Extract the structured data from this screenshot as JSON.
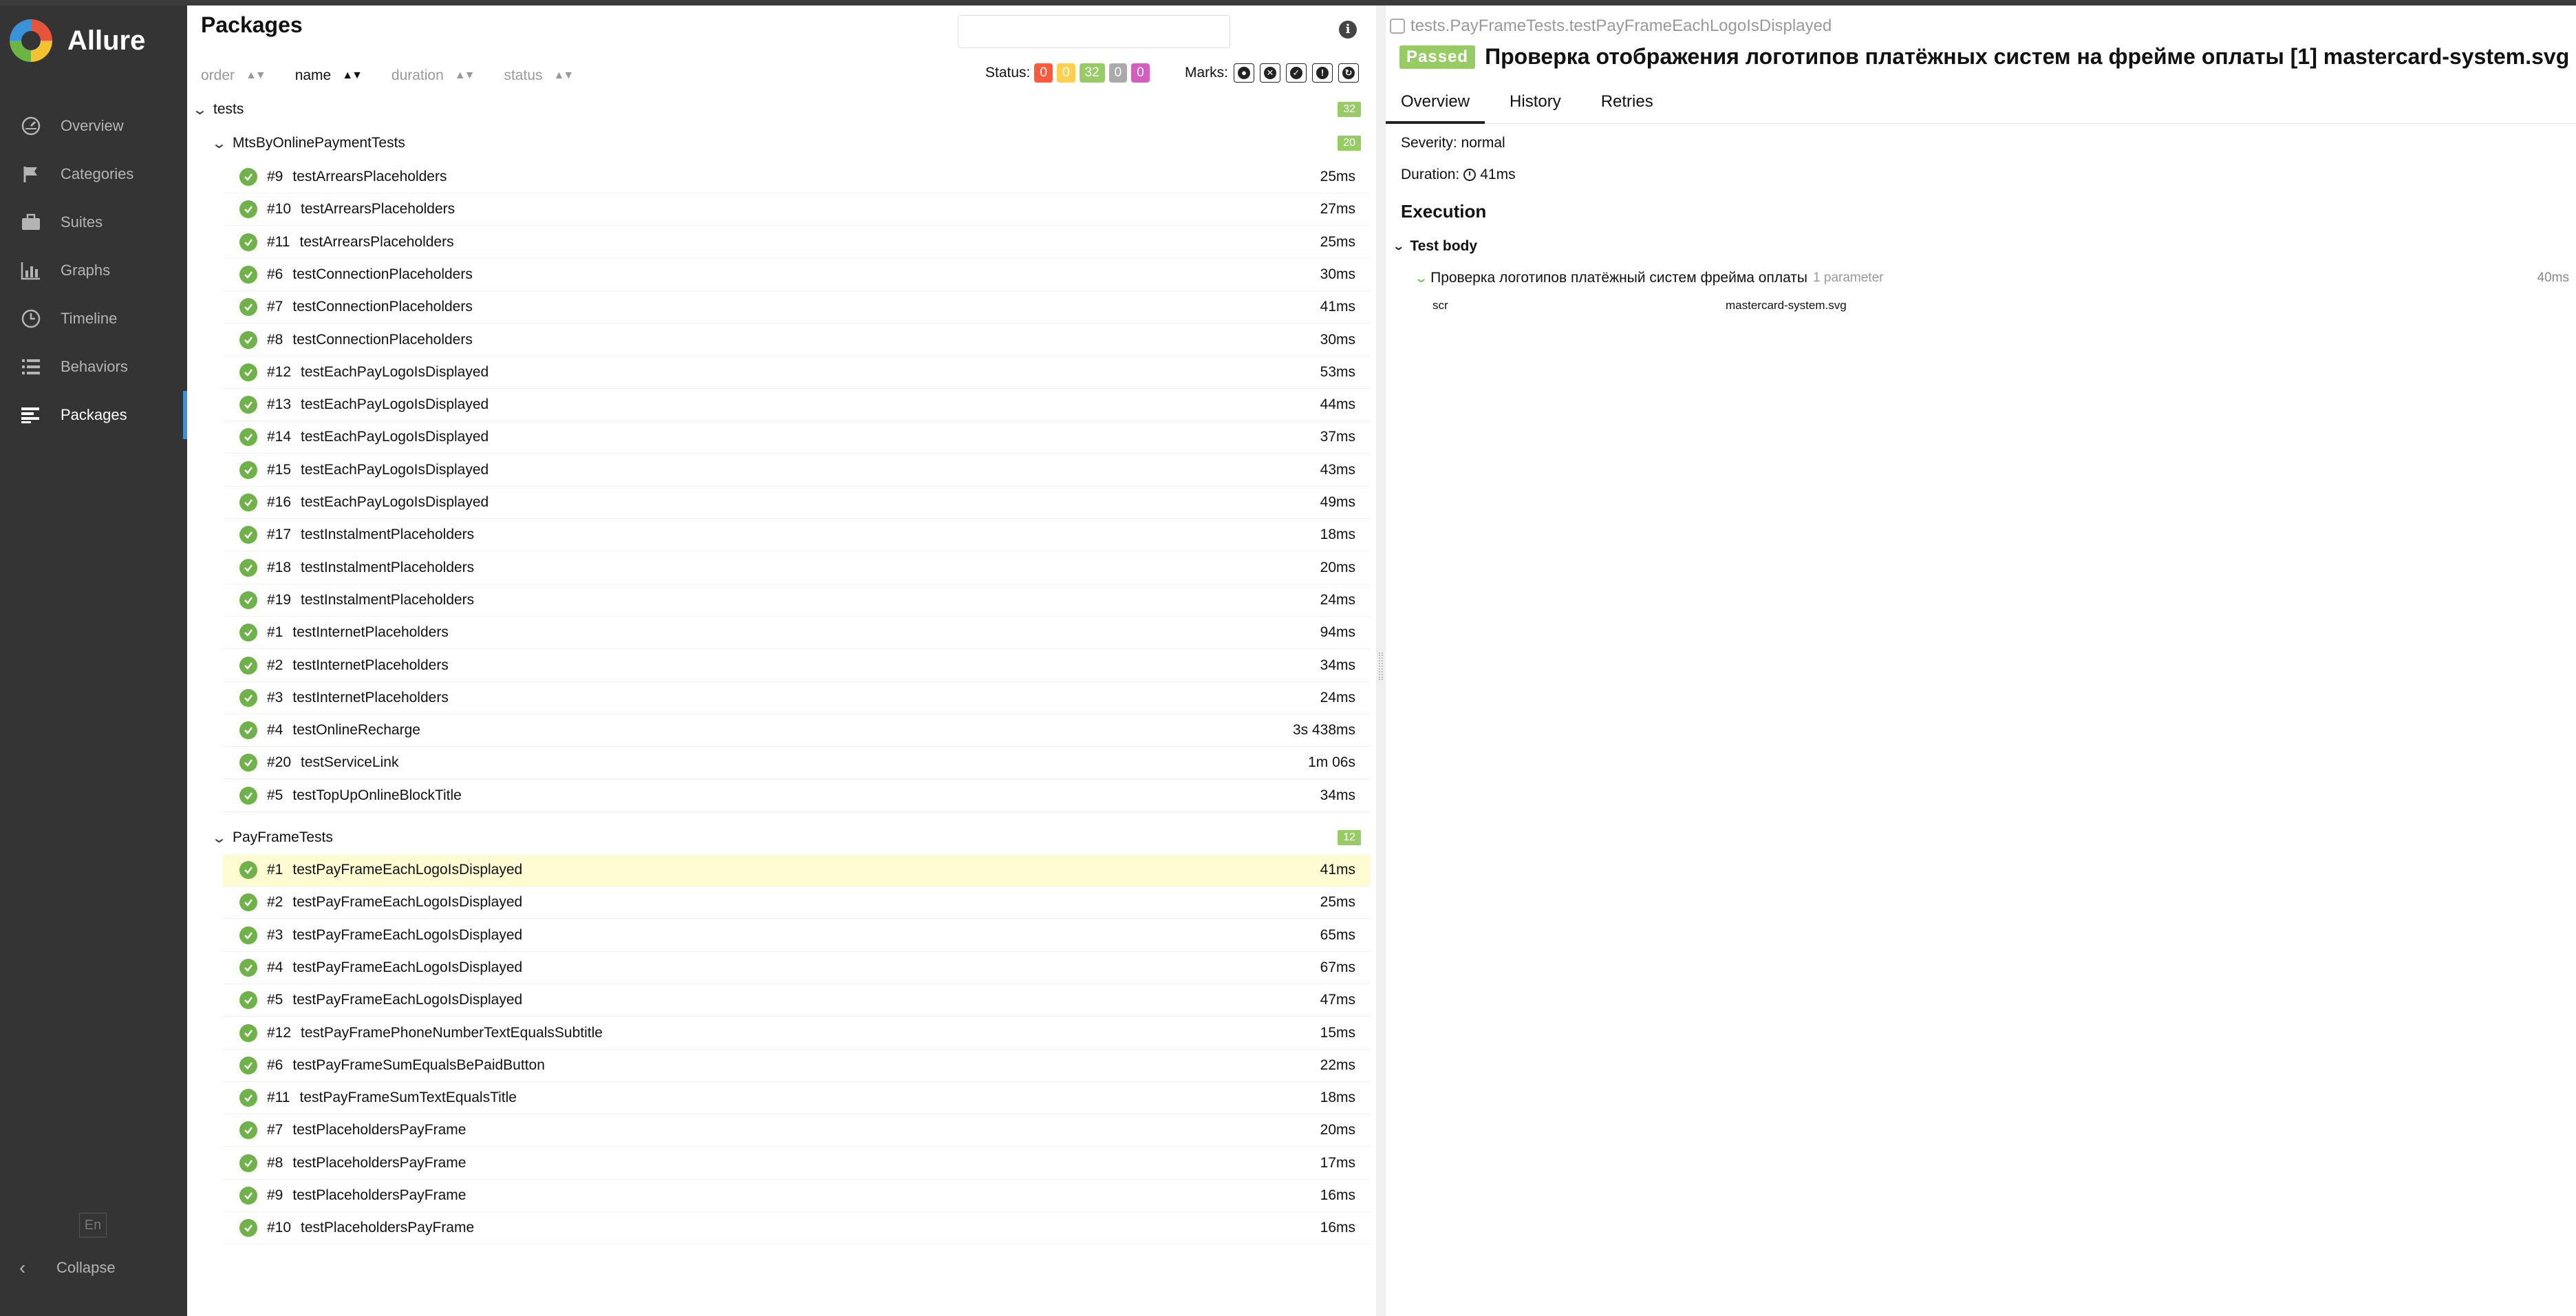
{
  "app": {
    "name": "Allure"
  },
  "sidebar": {
    "items": [
      {
        "label": "Overview",
        "icon": "overview-icon"
      },
      {
        "label": "Categories",
        "icon": "flag-icon"
      },
      {
        "label": "Suites",
        "icon": "briefcase-icon"
      },
      {
        "label": "Graphs",
        "icon": "bar-chart-icon"
      },
      {
        "label": "Timeline",
        "icon": "clock-icon"
      },
      {
        "label": "Behaviors",
        "icon": "list-icon"
      },
      {
        "label": "Packages",
        "icon": "packages-icon",
        "active": true
      }
    ],
    "lang": "En",
    "collapse": "Collapse"
  },
  "tree": {
    "title": "Packages",
    "sort": {
      "order": "order",
      "name": "name",
      "duration": "duration",
      "status": "status"
    },
    "status_label": "Status:",
    "status_counts": {
      "failed": "0",
      "broken": "0",
      "passed": "32",
      "skipped": "0",
      "unknown": "0"
    },
    "marks_label": "Marks:",
    "root": {
      "name": "tests",
      "count": "32"
    },
    "groups": [
      {
        "name": "MtsByOnlinePaymentTests",
        "count": "20"
      },
      {
        "name": "PayFrameTests",
        "count": "12"
      }
    ],
    "rows_g1": [
      {
        "num": "#9",
        "name": "testArrearsPlaceholders",
        "dur": "25ms"
      },
      {
        "num": "#10",
        "name": "testArrearsPlaceholders",
        "dur": "27ms"
      },
      {
        "num": "#11",
        "name": "testArrearsPlaceholders",
        "dur": "25ms"
      },
      {
        "num": "#6",
        "name": "testConnectionPlaceholders",
        "dur": "30ms"
      },
      {
        "num": "#7",
        "name": "testConnectionPlaceholders",
        "dur": "41ms"
      },
      {
        "num": "#8",
        "name": "testConnectionPlaceholders",
        "dur": "30ms"
      },
      {
        "num": "#12",
        "name": "testEachPayLogoIsDisplayed",
        "dur": "53ms"
      },
      {
        "num": "#13",
        "name": "testEachPayLogoIsDisplayed",
        "dur": "44ms"
      },
      {
        "num": "#14",
        "name": "testEachPayLogoIsDisplayed",
        "dur": "37ms"
      },
      {
        "num": "#15",
        "name": "testEachPayLogoIsDisplayed",
        "dur": "43ms"
      },
      {
        "num": "#16",
        "name": "testEachPayLogoIsDisplayed",
        "dur": "49ms"
      },
      {
        "num": "#17",
        "name": "testInstalmentPlaceholders",
        "dur": "18ms"
      },
      {
        "num": "#18",
        "name": "testInstalmentPlaceholders",
        "dur": "20ms"
      },
      {
        "num": "#19",
        "name": "testInstalmentPlaceholders",
        "dur": "24ms"
      },
      {
        "num": "#1",
        "name": "testInternetPlaceholders",
        "dur": "94ms"
      },
      {
        "num": "#2",
        "name": "testInternetPlaceholders",
        "dur": "34ms"
      },
      {
        "num": "#3",
        "name": "testInternetPlaceholders",
        "dur": "24ms"
      },
      {
        "num": "#4",
        "name": "testOnlineRecharge",
        "dur": "3s 438ms"
      },
      {
        "num": "#20",
        "name": "testServiceLink",
        "dur": "1m 06s"
      },
      {
        "num": "#5",
        "name": "testTopUpOnlineBlockTitle",
        "dur": "34ms"
      }
    ],
    "rows_g2": [
      {
        "num": "#1",
        "name": "testPayFrameEachLogoIsDisplayed",
        "dur": "41ms",
        "selected": true
      },
      {
        "num": "#2",
        "name": "testPayFrameEachLogoIsDisplayed",
        "dur": "25ms"
      },
      {
        "num": "#3",
        "name": "testPayFrameEachLogoIsDisplayed",
        "dur": "65ms"
      },
      {
        "num": "#4",
        "name": "testPayFrameEachLogoIsDisplayed",
        "dur": "67ms"
      },
      {
        "num": "#5",
        "name": "testPayFrameEachLogoIsDisplayed",
        "dur": "47ms"
      },
      {
        "num": "#12",
        "name": "testPayFramePhoneNumberTextEqualsSubtitle",
        "dur": "15ms"
      },
      {
        "num": "#6",
        "name": "testPayFrameSumEqualsBePaidButton",
        "dur": "22ms"
      },
      {
        "num": "#11",
        "name": "testPayFrameSumTextEqualsTitle",
        "dur": "18ms"
      },
      {
        "num": "#7",
        "name": "testPlaceholdersPayFrame",
        "dur": "20ms"
      },
      {
        "num": "#8",
        "name": "testPlaceholdersPayFrame",
        "dur": "17ms"
      },
      {
        "num": "#9",
        "name": "testPlaceholdersPayFrame",
        "dur": "16ms"
      },
      {
        "num": "#10",
        "name": "testPlaceholdersPayFrame",
        "dur": "16ms"
      }
    ]
  },
  "detail": {
    "breadcrumb": "tests.PayFrameTests.testPayFrameEachLogoIsDisplayed",
    "status": "Passed",
    "title": "Проверка отображения логотипов платёжных систем на фрейме оплаты [1] mastercard-system.svg",
    "tabs": [
      "Overview",
      "History",
      "Retries"
    ],
    "severity": "Severity: normal",
    "duration_label": "Duration:",
    "duration": "41ms",
    "execution": "Execution",
    "test_body": "Test body",
    "step": {
      "name": "Проверка логотипов платёжный систем фрейма оплаты",
      "meta": "1 parameter",
      "dur": "40ms"
    },
    "param": {
      "key": "scr",
      "value": "mastercard-system.svg"
    }
  },
  "colors": {
    "passed": "#97cc64",
    "failed": "#fd5a3e",
    "broken": "#ffd050",
    "skipped": "#aaaaaa",
    "unknown": "#d35ebe",
    "accent": "#3a93d8",
    "selected_row": "#fffbd2"
  }
}
